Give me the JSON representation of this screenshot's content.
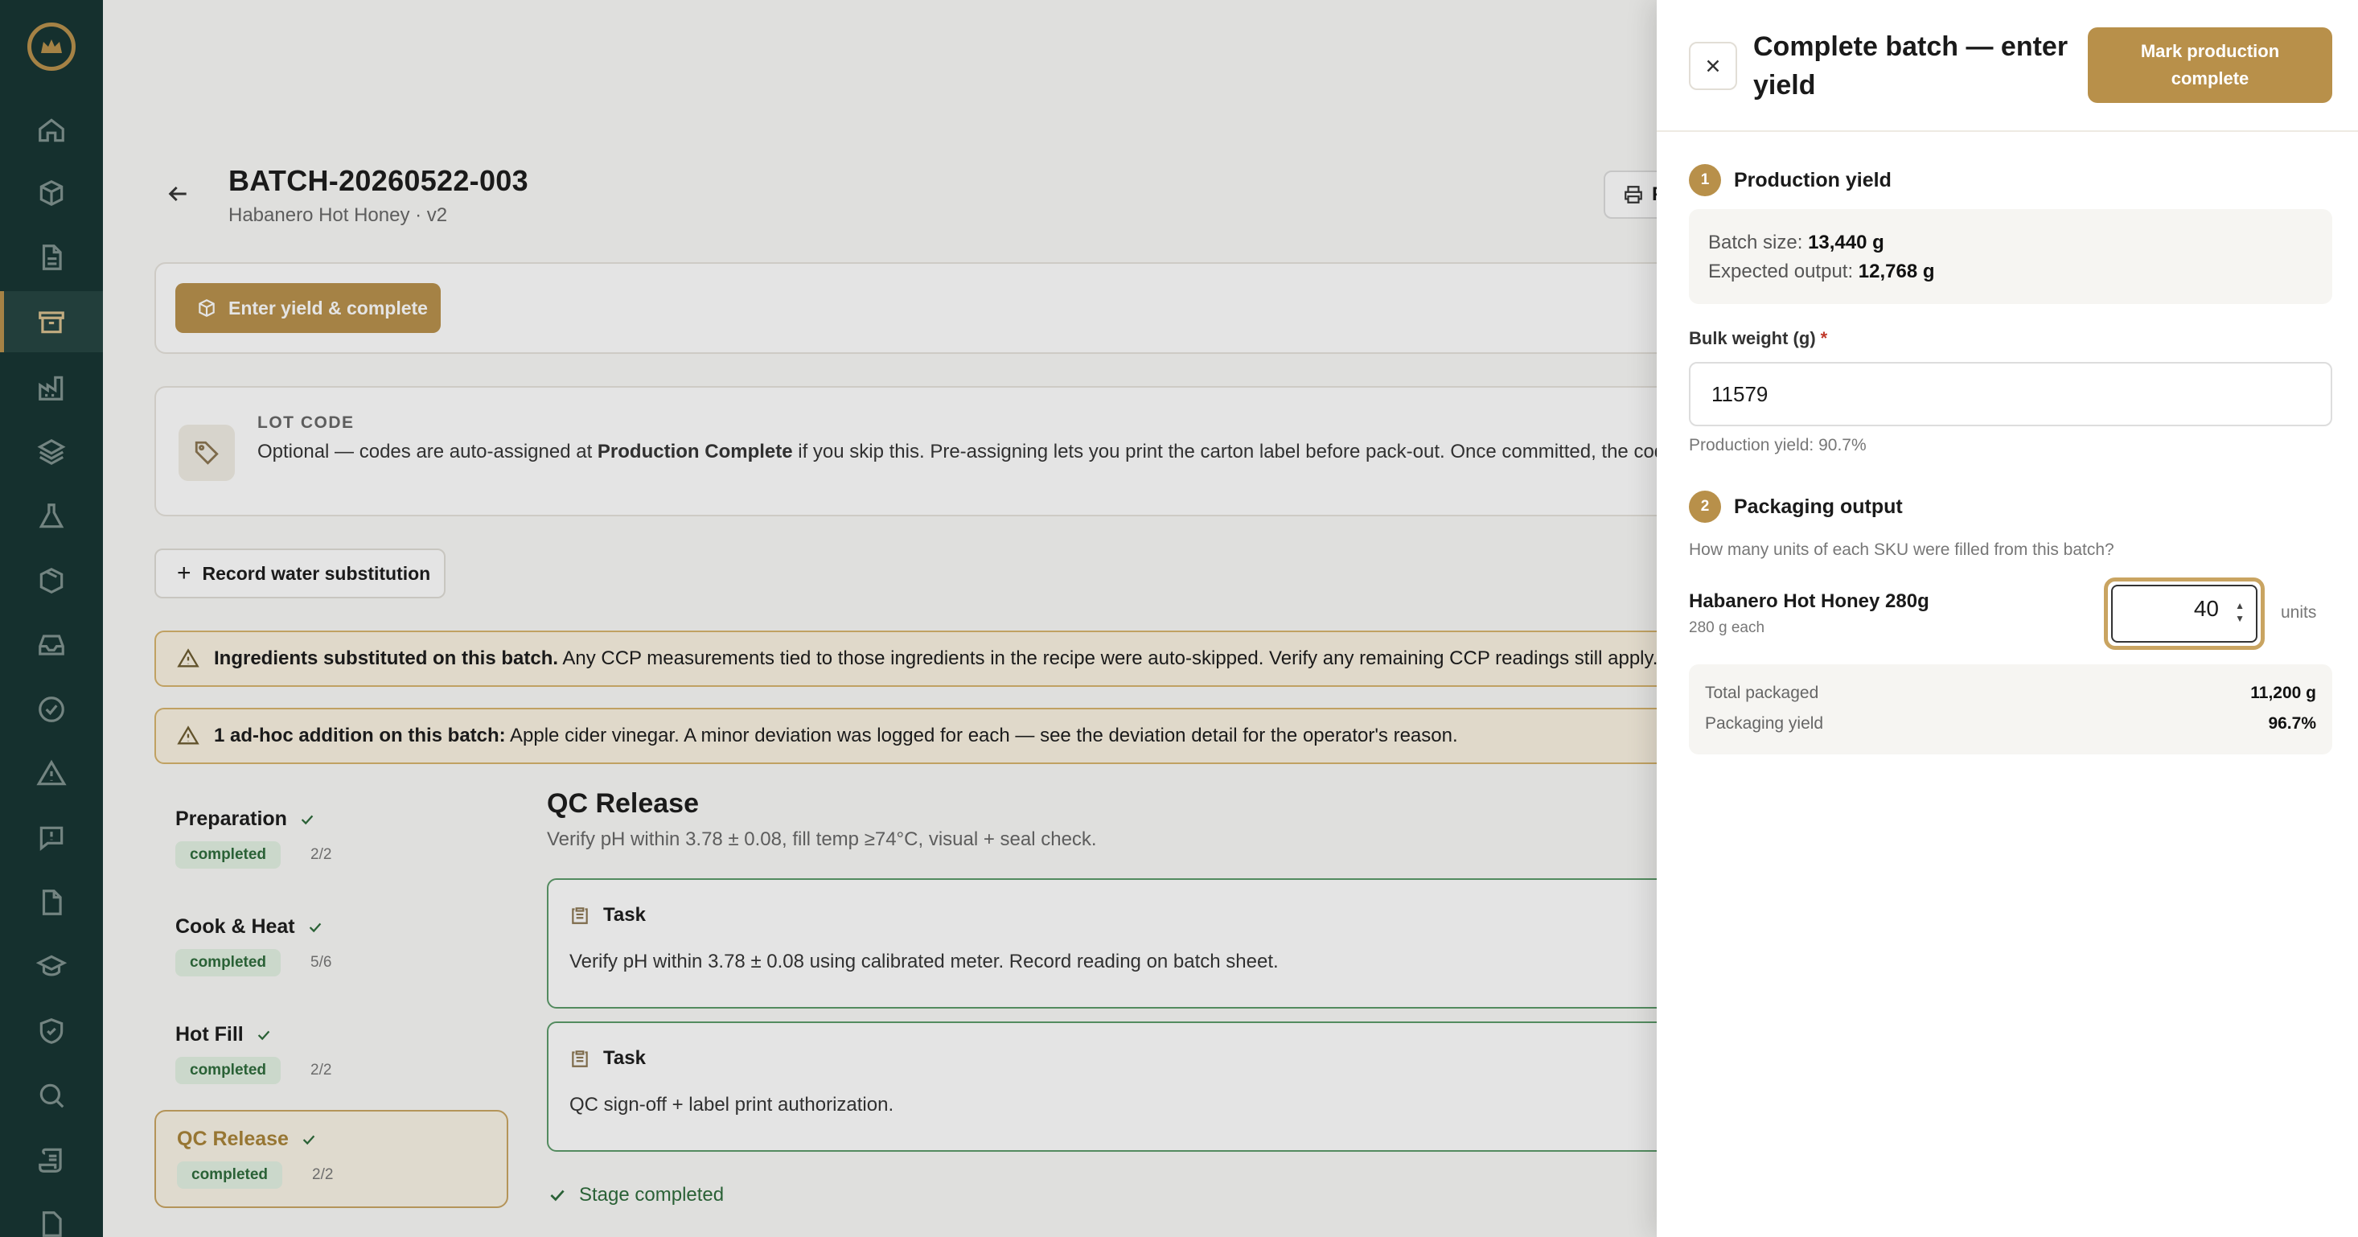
{
  "header": {
    "title": "BATCH-20260522-003",
    "subtitle": "Habanero Hot Honey · v2",
    "print_label": "P"
  },
  "actions": {
    "enter_yield_label": "Enter yield & complete",
    "water_sub_label": "Record water substitution"
  },
  "lot_code": {
    "label": "LOT CODE",
    "text_before": "Optional — codes are auto-assigned at ",
    "text_bold": "Production Complete",
    "text_after": " if you skip this. Pre-assigning lets you print the carton label before pack-out. Once committed, the code is locked."
  },
  "alerts": [
    {
      "bold": "Ingredients substituted on this batch.",
      "text": " Any CCP measurements tied to those ingredients in the recipe were auto-skipped. Verify any remaining CCP readings still apply."
    },
    {
      "bold": "1 ad-hoc addition on this batch:",
      "text": " Apple cider vinegar. A minor deviation was logged for each — see the deviation detail for the operator's reason."
    }
  ],
  "stages": [
    {
      "name": "Preparation",
      "status": "completed",
      "count": "2/2"
    },
    {
      "name": "Cook & Heat",
      "status": "completed",
      "count": "5/6"
    },
    {
      "name": "Hot Fill",
      "status": "completed",
      "count": "2/2"
    },
    {
      "name": "QC Release",
      "status": "completed",
      "count": "2/2"
    }
  ],
  "qc": {
    "title": "QC Release",
    "description": "Verify pH within 3.78 ± 0.08, fill temp ≥74°C, visual + seal check.",
    "tasks": [
      {
        "label": "Task",
        "text": "Verify pH within 3.78 ± 0.08 using calibrated meter. Record reading on batch sheet."
      },
      {
        "label": "Task",
        "text": "QC sign-off + label print authorization."
      }
    ],
    "stage_done": "Stage completed"
  },
  "drawer": {
    "title": "Complete batch — enter yield",
    "mark_button": "Mark production complete",
    "step1": {
      "num": "1",
      "title": "Production yield",
      "batch_size_label": "Batch size: ",
      "batch_size": "13,440 g",
      "expected_label": "Expected output: ",
      "expected": "12,768 g",
      "bulk_label": "Bulk weight (g)",
      "required_mark": "*",
      "bulk_value": "11579",
      "yield_hint": "Production yield: 90.7%"
    },
    "step2": {
      "num": "2",
      "title": "Packaging output",
      "question": "How many units of each SKU were filled from this batch?",
      "sku_name": "Habanero Hot Honey 280g",
      "sku_sub": "280 g each",
      "units_value": "40",
      "units_label": "units",
      "total_label": "Total packaged",
      "total_value": "11,200 g",
      "pkg_yield_label": "Packaging yield",
      "pkg_yield_value": "96.7%"
    }
  },
  "colors": {
    "sidebar": "#143330",
    "accent": "#b8904a",
    "success": "#2c6a3a"
  }
}
